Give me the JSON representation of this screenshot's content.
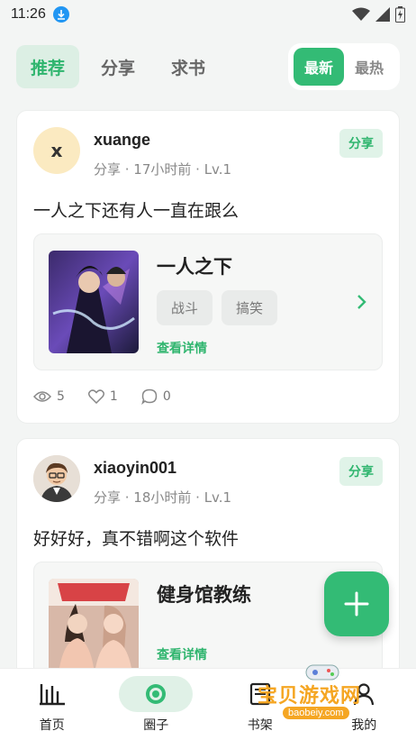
{
  "status_bar": {
    "time": "11:26"
  },
  "top_tabs": [
    {
      "label": "推荐",
      "active": true
    },
    {
      "label": "分享",
      "active": false
    },
    {
      "label": "求书",
      "active": false
    }
  ],
  "sort_options": [
    {
      "label": "最新",
      "active": true
    },
    {
      "label": "最热",
      "active": false
    }
  ],
  "posts": [
    {
      "avatar_letter": "x",
      "username": "xuange",
      "meta": "分享 · 17小时前 · Lv.1",
      "badge": "分享",
      "text": "一人之下还有人一直在跟么",
      "book": {
        "title": "一人之下",
        "tags": [
          "战斗",
          "搞笑"
        ],
        "detail_label": "查看详情"
      },
      "stats": {
        "views": "5",
        "likes": "1",
        "comments": "0"
      }
    },
    {
      "username": "xiaoyin001",
      "meta": "分享 · 18小时前 · Lv.1",
      "badge": "分享",
      "text": "好好好，真不错啊这个软件",
      "book": {
        "title": "健身馆教练",
        "detail_label": "查看详情"
      }
    }
  ],
  "bottom_nav": [
    {
      "label": "首页",
      "icon": "chart-bars-icon",
      "active": false
    },
    {
      "label": "圈子",
      "icon": "target-circle-icon",
      "active": true
    },
    {
      "label": "书架",
      "icon": "bookshelf-icon",
      "active": false
    },
    {
      "label": "我的",
      "icon": "user-icon",
      "active": false
    }
  ],
  "watermark": {
    "text": "宝贝游戏网",
    "url": "baobeiy.com"
  },
  "colors": {
    "accent": "#33bb75",
    "accent_light": "#dcefe4",
    "background": "#f3f5f4"
  }
}
